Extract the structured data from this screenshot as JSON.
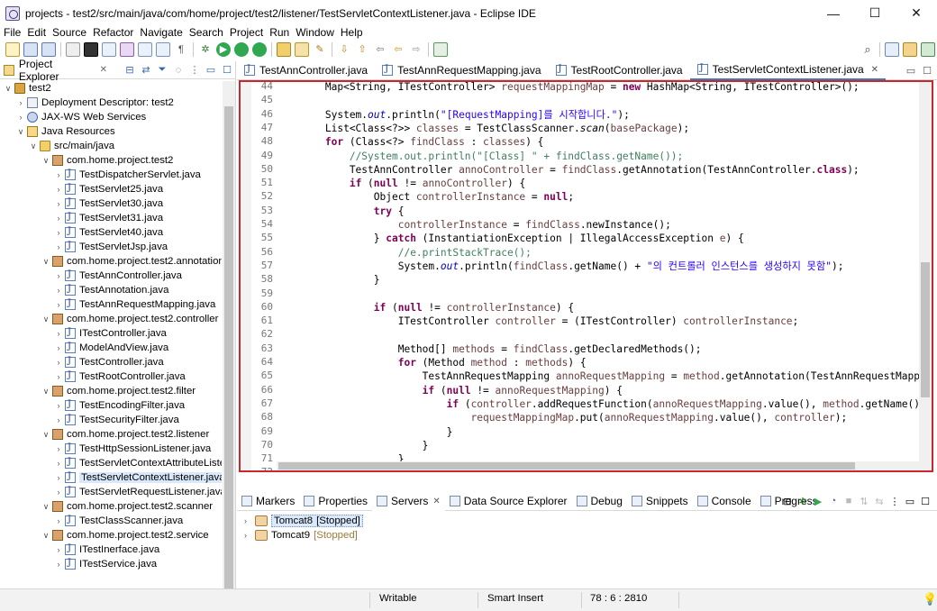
{
  "window": {
    "title": "projects - test2/src/main/java/com/home/project/test2/listener/TestServletContextListener.java - Eclipse IDE",
    "minimize": "—",
    "maximize": "☐",
    "close": "✕"
  },
  "menu": [
    "File",
    "Edit",
    "Source",
    "Refactor",
    "Navigate",
    "Search",
    "Project",
    "Run",
    "Window",
    "Help"
  ],
  "explorer": {
    "title": "Project Explorer",
    "close": "✕",
    "tree": [
      {
        "label": "test2",
        "arrow": "∨",
        "icon": "project"
      },
      {
        "label": "Deployment Descriptor: test2",
        "arrow": "›",
        "icon": "desc"
      },
      {
        "label": "JAX-WS Web Services",
        "arrow": "›",
        "icon": "jaxws"
      },
      {
        "label": "Java Resources",
        "arrow": "∨",
        "icon": "javares"
      },
      {
        "label": "src/main/java",
        "arrow": "∨",
        "icon": "folder"
      },
      {
        "label": "com.home.project.test2",
        "arrow": "∨",
        "icon": "pkg"
      },
      {
        "label": "TestDispatcherServlet.java",
        "arrow": "›",
        "icon": "java"
      },
      {
        "label": "TestServlet25.java",
        "arrow": "›",
        "icon": "java"
      },
      {
        "label": "TestServlet30.java",
        "arrow": "›",
        "icon": "java"
      },
      {
        "label": "TestServlet31.java",
        "arrow": "›",
        "icon": "java"
      },
      {
        "label": "TestServlet40.java",
        "arrow": "›",
        "icon": "java"
      },
      {
        "label": "TestServletJsp.java",
        "arrow": "›",
        "icon": "java"
      },
      {
        "label": "com.home.project.test2.annotation",
        "arrow": "∨",
        "icon": "pkg"
      },
      {
        "label": "TestAnnController.java",
        "arrow": "›",
        "icon": "java"
      },
      {
        "label": "TestAnnotation.java",
        "arrow": "›",
        "icon": "java"
      },
      {
        "label": "TestAnnRequestMapping.java",
        "arrow": "›",
        "icon": "java"
      },
      {
        "label": "com.home.project.test2.controller",
        "arrow": "∨",
        "icon": "pkg"
      },
      {
        "label": "ITestController.java",
        "arrow": "›",
        "icon": "java"
      },
      {
        "label": "ModelAndView.java",
        "arrow": "›",
        "icon": "java"
      },
      {
        "label": "TestController.java",
        "arrow": "›",
        "icon": "java"
      },
      {
        "label": "TestRootController.java",
        "arrow": "›",
        "icon": "java"
      },
      {
        "label": "com.home.project.test2.filter",
        "arrow": "∨",
        "icon": "pkg"
      },
      {
        "label": "TestEncodingFilter.java",
        "arrow": "›",
        "icon": "java"
      },
      {
        "label": "TestSecurityFilter.java",
        "arrow": "›",
        "icon": "java"
      },
      {
        "label": "com.home.project.test2.listener",
        "arrow": "∨",
        "icon": "pkg"
      },
      {
        "label": "TestHttpSessionListener.java",
        "arrow": "›",
        "icon": "java"
      },
      {
        "label": "TestServletContextAttributeListe",
        "arrow": "›",
        "icon": "java"
      },
      {
        "label": "TestServletContextListener.java",
        "arrow": "›",
        "icon": "java",
        "selected": true
      },
      {
        "label": "TestServletRequestListener.java",
        "arrow": "›",
        "icon": "java"
      },
      {
        "label": "com.home.project.test2.scanner",
        "arrow": "∨",
        "icon": "pkg"
      },
      {
        "label": "TestClassScanner.java",
        "arrow": "›",
        "icon": "java"
      },
      {
        "label": "com.home.project.test2.service",
        "arrow": "∨",
        "icon": "pkg"
      },
      {
        "label": "ITestInerface.java",
        "arrow": "›",
        "icon": "java"
      },
      {
        "label": "ITestService.java",
        "arrow": "›",
        "icon": "java"
      }
    ]
  },
  "editor_tabs": [
    {
      "label": "TestAnnController.java",
      "active": false
    },
    {
      "label": "TestAnnRequestMapping.java",
      "active": false
    },
    {
      "label": "TestRootController.java",
      "active": false
    },
    {
      "label": "TestServletContextListener.java",
      "active": true
    }
  ],
  "code_lines": [
    {
      "n": "44",
      "html": "        Map&lt;String, ITestController&gt; <span class='var'>requestMappingMap</span> = <span class='kw'>new</span> HashMap&lt;String, ITestController&gt;();"
    },
    {
      "n": "45",
      "html": ""
    },
    {
      "n": "46",
      "html": "        System.<span class='fld'>out</span>.println(<span class='str'>\"[RequestMapping]를 시작합니다.\"</span>);"
    },
    {
      "n": "47",
      "html": "        List&lt;Class&lt;?&gt;&gt; <span class='var'>classes</span> = TestClassScanner.<span class='ital'>scan</span>(<span class='var'>basePackage</span>);"
    },
    {
      "n": "48",
      "html": "        <span class='kw'>for</span> (Class&lt;?&gt; <span class='var'>findClass</span> : <span class='var'>classes</span>) {"
    },
    {
      "n": "49",
      "html": "            <span class='cm'>//System.out.println(\"[Class] \" + findClass.getName());</span>"
    },
    {
      "n": "50",
      "html": "            TestAnnController <span class='var'>annoController</span> = <span class='var'>findClass</span>.getAnnotation(TestAnnController.<span class='kw'>class</span>);"
    },
    {
      "n": "51",
      "html": "            <span class='kw'>if</span> (<span class='kw'>null</span> != <span class='var'>annoController</span>) {"
    },
    {
      "n": "52",
      "html": "                Object <span class='var'>controllerInstance</span> = <span class='kw'>null</span>;"
    },
    {
      "n": "53",
      "html": "                <span class='kw'>try</span> {"
    },
    {
      "n": "54",
      "html": "                    <span class='var'>controllerInstance</span> = <span class='var'>findClass</span>.newInstance();"
    },
    {
      "n": "55",
      "html": "                } <span class='kw'>catch</span> (InstantiationException | IllegalAccessException <span class='var'>e</span>) {"
    },
    {
      "n": "56",
      "html": "                    <span class='cm'>//e.printStackTrace();</span>"
    },
    {
      "n": "57",
      "html": "                    System.<span class='fld'>out</span>.println(<span class='var'>findClass</span>.getName() + <span class='str'>\"의 컨트롤러 인스턴스를 생성하지 못함\"</span>);"
    },
    {
      "n": "58",
      "html": "                }"
    },
    {
      "n": "59",
      "html": ""
    },
    {
      "n": "60",
      "html": "                <span class='kw'>if</span> (<span class='kw'>null</span> != <span class='var'>controllerInstance</span>) {"
    },
    {
      "n": "61",
      "html": "                    ITestController <span class='var'>controller</span> = (ITestController) <span class='var'>controllerInstance</span>;"
    },
    {
      "n": "62",
      "html": ""
    },
    {
      "n": "63",
      "html": "                    Method[] <span class='var'>methods</span> = <span class='var'>findClass</span>.getDeclaredMethods();"
    },
    {
      "n": "64",
      "html": "                    <span class='kw'>for</span> (Method <span class='var'>method</span> : <span class='var'>methods</span>) {"
    },
    {
      "n": "65",
      "html": "                        TestAnnRequestMapping <span class='var'>annoRequestMapping</span> = <span class='var'>method</span>.getAnnotation(TestAnnRequestMapp"
    },
    {
      "n": "66",
      "html": "                        <span class='kw'>if</span> (<span class='kw'>null</span> != <span class='var'>annoRequestMapping</span>) {"
    },
    {
      "n": "67",
      "html": "                            <span class='kw'>if</span> (<span class='var'>controller</span>.addRequestFunction(<span class='var'>annoRequestMapping</span>.value(), <span class='var'>method</span>.getName()"
    },
    {
      "n": "68",
      "html": "                                <span class='var'>requestMappingMap</span>.put(<span class='var'>annoRequestMapping</span>.value(), <span class='var'>controller</span>);"
    },
    {
      "n": "69",
      "html": "                            }"
    },
    {
      "n": "70",
      "html": "                        }"
    },
    {
      "n": "71",
      "html": "                    }"
    },
    {
      "n": "72",
      "html": "                }"
    }
  ],
  "bottom_tabs": [
    {
      "label": "Markers",
      "active": false,
      "close": ""
    },
    {
      "label": "Properties",
      "active": false,
      "close": ""
    },
    {
      "label": "Servers",
      "active": true,
      "close": "✕"
    },
    {
      "label": "Data Source Explorer",
      "active": false,
      "close": ""
    },
    {
      "label": "Debug",
      "active": false,
      "close": ""
    },
    {
      "label": "Snippets",
      "active": false,
      "close": ""
    },
    {
      "label": "Console",
      "active": false,
      "close": ""
    },
    {
      "label": "Progress",
      "active": false,
      "close": ""
    }
  ],
  "servers": [
    {
      "name": "Tomcat8",
      "state": "[Stopped]",
      "selected": true
    },
    {
      "name": "Tomcat9",
      "state": "[Stopped]",
      "selected": false
    }
  ],
  "status": {
    "writable": "Writable",
    "insert_mode": "Smart Insert",
    "position": "78 : 6 : 2810"
  },
  "colors": {
    "editor_highlight_border": "#c8282d",
    "keyword": "#7f0055",
    "string": "#2a00ff",
    "comment": "#3f7f5f"
  }
}
